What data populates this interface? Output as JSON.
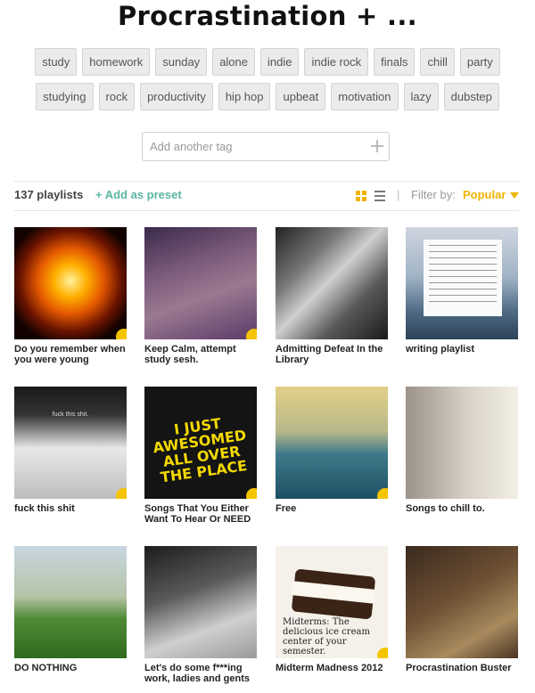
{
  "page": {
    "title": "Procrastination + ..."
  },
  "tags": {
    "row1": [
      "study",
      "homework",
      "sunday",
      "alone",
      "indie",
      "indie rock",
      "finals",
      "chill",
      "party"
    ],
    "row2": [
      "studying",
      "rock",
      "productivity",
      "hip hop",
      "upbeat",
      "motivation",
      "lazy",
      "dubstep"
    ]
  },
  "add_tag": {
    "placeholder": "Add another tag"
  },
  "toolbar": {
    "count": "137 playlists",
    "preset": "+ Add as preset",
    "separator": "|",
    "filter_label": "Filter by:",
    "filter_value": "Popular"
  },
  "icons": {
    "grid": "grid-view-icon",
    "list": "list-view-icon",
    "add": "plus-icon",
    "dropdown": "caret-down-icon",
    "play": "play-badge-icon"
  },
  "colors": {
    "accent": "#f0b400",
    "preset": "#5bb5a2"
  },
  "playlists": [
    {
      "title": "Do you remember when you were young"
    },
    {
      "title": "Keep Calm, attempt study sesh."
    },
    {
      "title": "Admitting Defeat In the Library"
    },
    {
      "title": "writing playlist"
    },
    {
      "title": "fuck this shit",
      "image_text": "fuck this shit."
    },
    {
      "title": "Songs That You Either Want To Hear Or NEED",
      "image_text": "I JUST AWESOMED ALL OVER THE PLACE"
    },
    {
      "title": "Free"
    },
    {
      "title": "Songs to chill to."
    },
    {
      "title": "DO NOTHING"
    },
    {
      "title": "Let's do some f***ing work, ladies and gents"
    },
    {
      "title": "Midterm Madness 2012",
      "image_text": "Midterms: The delicious ice cream center of your semester."
    },
    {
      "title": "Procrastination Buster"
    }
  ]
}
